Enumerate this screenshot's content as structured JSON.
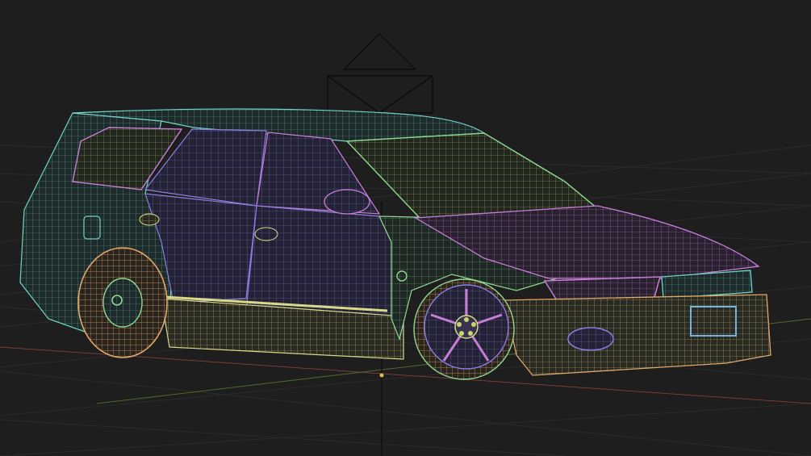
{
  "viewport": {
    "background": "#1e1e1e",
    "grid_color": "#2b2b2b",
    "x_axis_color": "#7a3b3b",
    "y_axis_color": "#4f6b2a",
    "z_axis_color": "#101010"
  },
  "model": {
    "kind": "car wireframe (station wagon)",
    "mesh_colors": {
      "body_green": "#8fd98f",
      "body_purple": "#8b7fe0",
      "body_cyan": "#6fd6c8",
      "magenta": "#c77ed6",
      "yellow": "#d9d98a",
      "orange": "#e0a86a",
      "glass_yellow": "#c9d670",
      "plate_blue": "#6fb4e0"
    }
  },
  "camera_gizmo": {
    "icon": "camera-icon"
  },
  "origin_marker": {
    "color": "#e0c040"
  }
}
